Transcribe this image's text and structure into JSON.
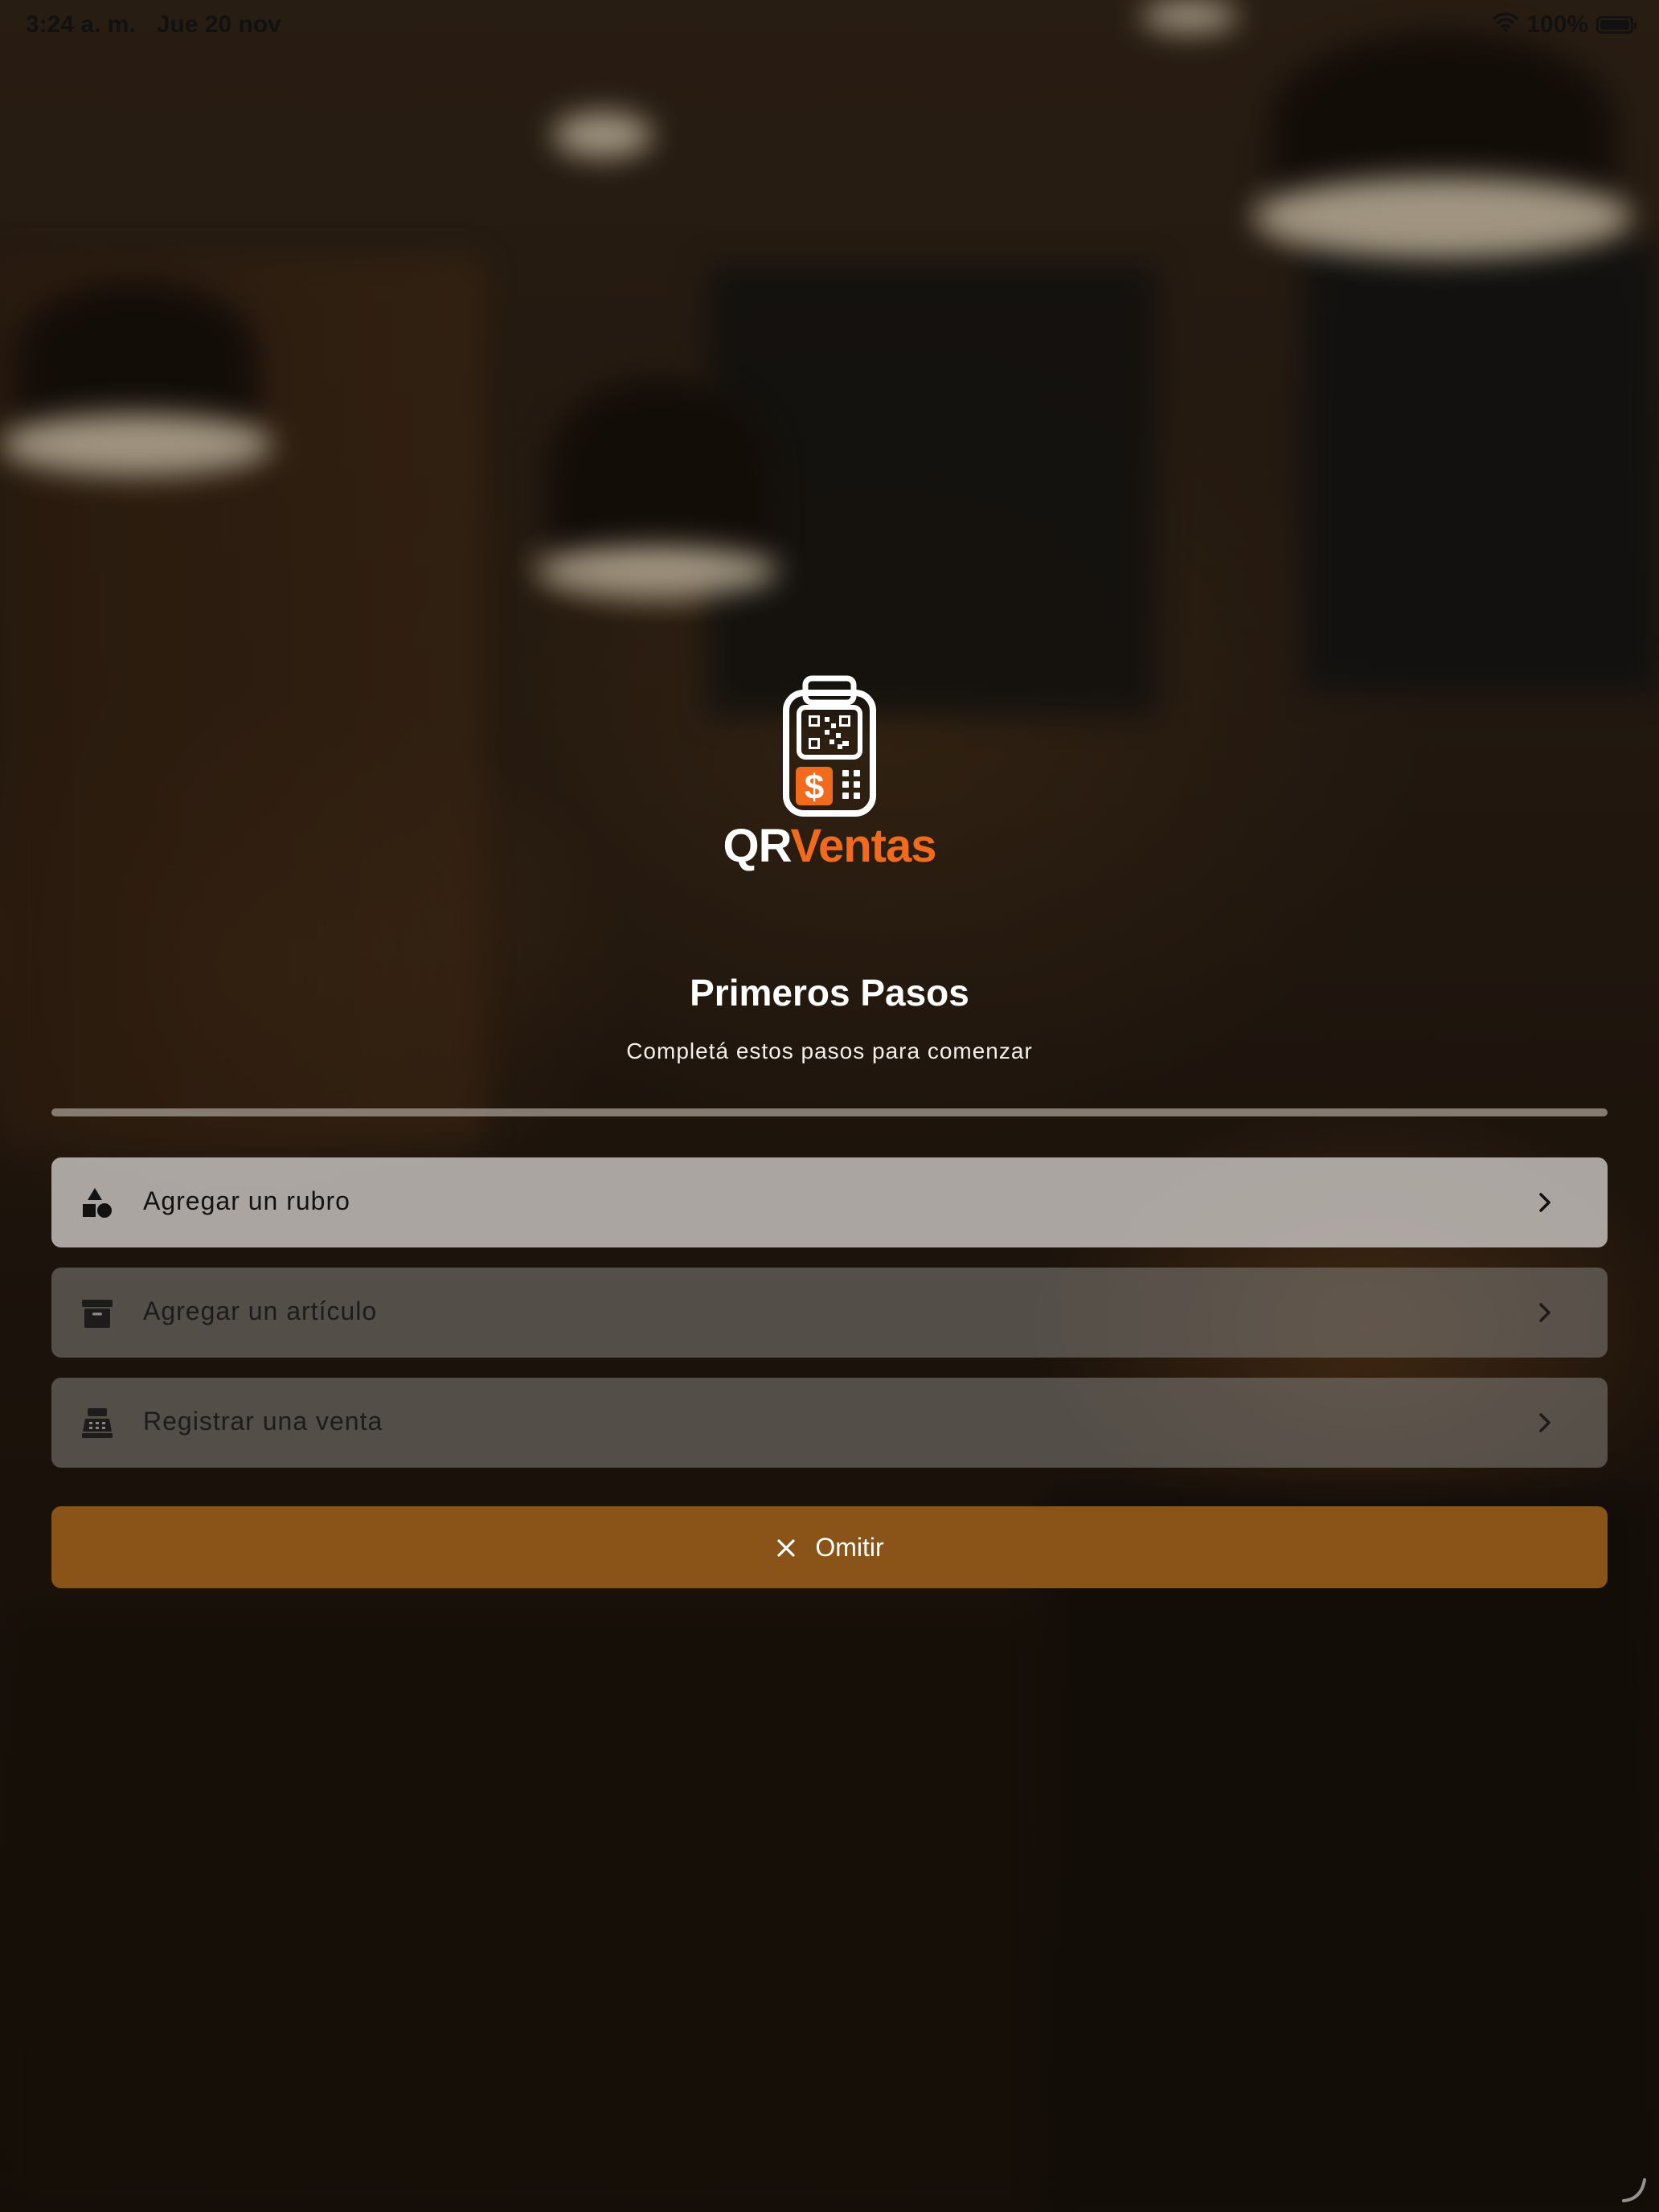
{
  "status_bar": {
    "time": "3:24 a. m.",
    "date": "Jue 20 nov",
    "battery": "100%"
  },
  "logo": {
    "name_part1": "QR",
    "name_part2": "Ventas",
    "accent_color": "#f26b1d"
  },
  "header": {
    "title": "Primeros Pasos",
    "subtitle": "Completá estos pasos para comenzar"
  },
  "progress": {
    "fraction": 0.0
  },
  "steps": [
    {
      "label": "Agregar un rubro",
      "icon": "shapes-icon",
      "state": "active"
    },
    {
      "label": "Agregar un artículo",
      "icon": "archive-box-icon",
      "state": "pending"
    },
    {
      "label": "Registrar una venta",
      "icon": "cash-register-icon",
      "state": "pending"
    }
  ],
  "skip": {
    "label": "Omitir",
    "icon": "close-icon",
    "color": "#8a5418"
  }
}
